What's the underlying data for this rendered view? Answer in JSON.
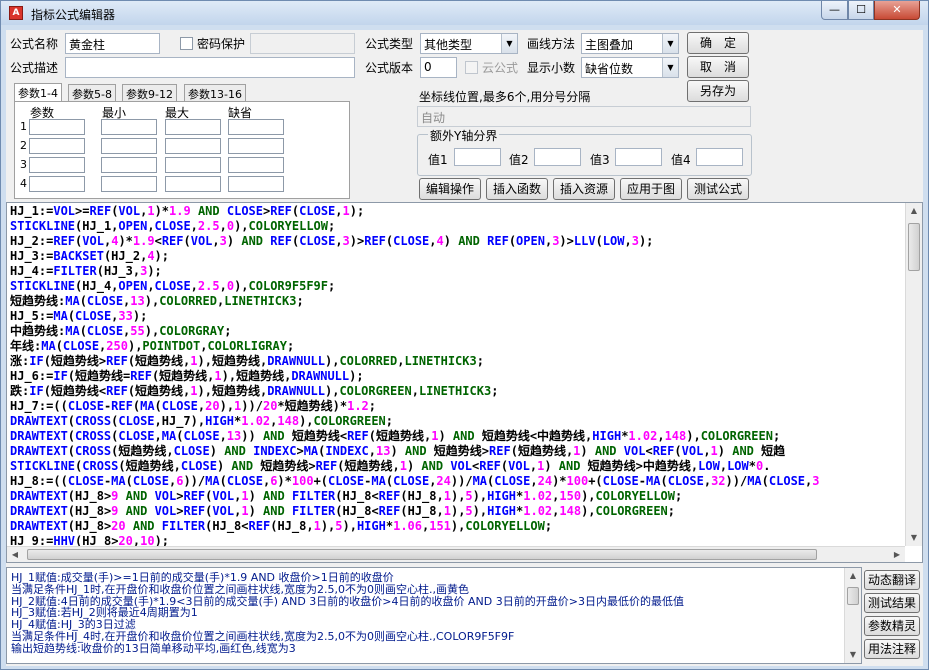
{
  "window": {
    "title": "指标公式编辑器",
    "icon_char": "A",
    "min_glyph": "—",
    "max_glyph": "☐",
    "close_glyph": "✕"
  },
  "form": {
    "name_label": "公式名称",
    "name_value": "黄金柱",
    "password_label": "密码保护",
    "desc_label": "公式描述",
    "desc_value": "",
    "type_label": "公式类型",
    "type_value": "其他类型",
    "draw_label": "画线方法",
    "draw_value": "主图叠加",
    "version_label": "公式版本",
    "version_value": "0",
    "cloud_label": "云公式",
    "decimals_label": "显示小数",
    "decimals_value": "缺省位数"
  },
  "buttons": {
    "ok": "确　定",
    "cancel": "取　消",
    "save_as": "另存为",
    "edit_ops": "编辑操作",
    "insert_func": "插入函数",
    "insert_res": "插入资源",
    "apply_chart": "应用于图",
    "test_formula": "测试公式"
  },
  "param_tabs": [
    "参数1-4",
    "参数5-8",
    "参数9-12",
    "参数13-16"
  ],
  "param_headers": [
    "参数",
    "最小",
    "最大",
    "缺省"
  ],
  "param_rows": [
    "1",
    "2",
    "3",
    "4"
  ],
  "coord": {
    "label": "坐标线位置,最多6个,用分号分隔",
    "value": "自动"
  },
  "yaxis": {
    "title": "额外Y轴分界",
    "labels": [
      "值1",
      "值2",
      "值3",
      "值4"
    ]
  },
  "code_lines": [
    "HJ_1:=VOL>=REF(VOL,1)*1.9 AND CLOSE>REF(CLOSE,1);",
    "STICKLINE(HJ_1,OPEN,CLOSE,2.5,0),COLORYELLOW;",
    "HJ_2:=REF(VOL,4)*1.9<REF(VOL,3) AND REF(CLOSE,3)>REF(CLOSE,4) AND REF(OPEN,3)>LLV(LOW,3);",
    "HJ_3:=BACKSET(HJ_2,4);",
    "HJ_4:=FILTER(HJ_3,3);",
    "STICKLINE(HJ_4,OPEN,CLOSE,2.5,0),COLOR9F5F9F;",
    "短趋势线:MA(CLOSE,13),COLORRED,LINETHICK3;",
    "HJ_5:=MA(CLOSE,33);",
    "中趋势线:MA(CLOSE,55),COLORGRAY;",
    "年线:MA(CLOSE,250),POINTDOT,COLORLIGRAY;",
    "涨:IF(短趋势线>REF(短趋势线,1),短趋势线,DRAWNULL),COLORRED,LINETHICK3;",
    "HJ_6:=IF(短趋势线=REF(短趋势线,1),短趋势线,DRAWNULL);",
    "跌:IF(短趋势线<REF(短趋势线,1),短趋势线,DRAWNULL),COLORGREEN,LINETHICK3;",
    "HJ_7:=((CLOSE-REF(MA(CLOSE,20),1))/20*短趋势线)*1.2;",
    "DRAWTEXT(CROSS(CLOSE,HJ_7),HIGH*1.02,148),COLORGREEN;",
    "DRAWTEXT(CROSS(CLOSE,MA(CLOSE,13)) AND 短趋势线<REF(短趋势线,1) AND 短趋势线<中趋势线,HIGH*1.02,148),COLORGREEN;",
    "DRAWTEXT(CROSS(短趋势线,CLOSE) AND INDEXC>MA(INDEXC,13) AND 短趋势线>REF(短趋势线,1) AND VOL<REF(VOL,1) AND 短趋",
    "STICKLINE(CROSS(短趋势线,CLOSE) AND 短趋势线>REF(短趋势线,1) AND VOL<REF(VOL,1) AND 短趋势线>中趋势线,LOW,LOW*0.",
    "HJ_8:=((CLOSE-MA(CLOSE,6))/MA(CLOSE,6)*100+(CLOSE-MA(CLOSE,24))/MA(CLOSE,24)*100+(CLOSE-MA(CLOSE,32))/MA(CLOSE,3",
    "DRAWTEXT(HJ_8>9 AND VOL>REF(VOL,1) AND FILTER(HJ_8<REF(HJ_8,1),5),HIGH*1.02,150),COLORYELLOW;",
    "DRAWTEXT(HJ_8>9 AND VOL>REF(VOL,1) AND FILTER(HJ_8<REF(HJ_8,1),5),HIGH*1.02,148),COLORGREEN;",
    "DRAWTEXT(HJ_8>20 AND FILTER(HJ_8<REF(HJ_8,1),5),HIGH*1.06,151),COLORYELLOW;",
    "HJ_9:=HHV(HJ_8>20,10);"
  ],
  "description_lines": [
    "HJ_1赋值:成交量(手)>=1日前的成交量(手)*1.9 AND 收盘价>1日前的收盘价",
    "当满足条件HJ_1时,在开盘价和收盘价位置之间画柱状线,宽度为2.5,0不为0则画空心柱.,画黄色",
    "HJ_2赋值:4日前的成交量(手)*1.9<3日前的成交量(手) AND 3日前的收盘价>4日前的收盘价 AND 3日前的开盘价>3日内最低价的最低值",
    "HJ_3赋值:若HJ_2则将最近4周期置为1",
    "HJ_4赋值:HJ_3的3日过滤",
    "当满足条件HJ_4时,在开盘价和收盘价位置之间画柱状线,宽度为2.5,0不为0则画空心柱.,COLOR9F5F9F",
    "输出短趋势线:收盘价的13日简单移动平均,画红色,线宽为3"
  ],
  "side_buttons": [
    "动态翻译",
    "测试结果",
    "参数精灵",
    "用法注释"
  ],
  "scroll_glyphs": {
    "up": "▲",
    "down": "▼",
    "left": "◀",
    "right": "▶",
    "dropdown": "▼"
  },
  "colors": {
    "keyword": "#006400",
    "function": "#0000ff",
    "number": "#ff00ff",
    "variable": "#000000",
    "description": "#001a8c"
  }
}
